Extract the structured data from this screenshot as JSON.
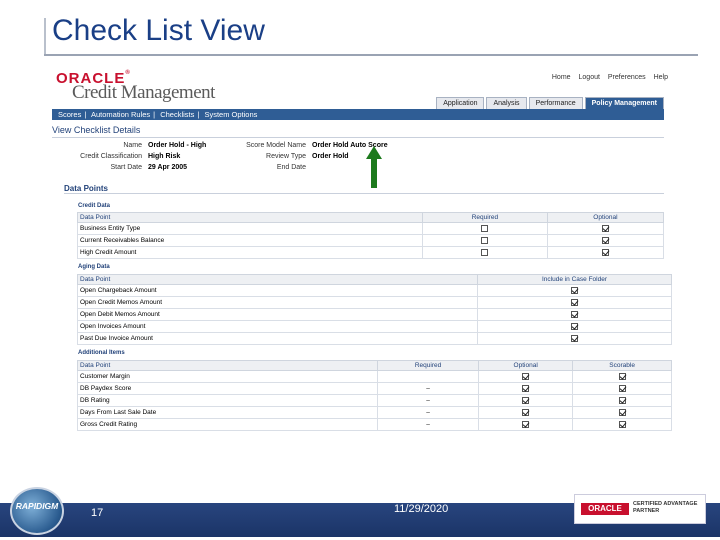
{
  "slide": {
    "title": "Check List View",
    "page_number": "17",
    "date": "11/29/2020"
  },
  "branding": {
    "footer_logo_text": "RAPIDIGM",
    "partner_oracle": "ORACLE",
    "partner_line1": "CERTIFIED ADVANTAGE",
    "partner_line2": "PARTNER"
  },
  "app": {
    "vendor": "ORACLE",
    "name": "Credit Management",
    "global_links": [
      "Home",
      "Logout",
      "Preferences",
      "Help"
    ],
    "tabs": [
      "Application",
      "Analysis",
      "Performance",
      "Policy Management"
    ],
    "active_tab": "Policy Management",
    "subnav": [
      "Scores",
      "Automation Rules",
      "Checklists",
      "System Options"
    ],
    "page_title": "View Checklist Details",
    "details": {
      "name_label": "Name",
      "name_value": "Order Hold - High",
      "classification_label": "Credit Classification",
      "classification_value": "High Risk",
      "start_label": "Start Date",
      "start_value": "29 Apr 2005",
      "score_label": "Score Model Name",
      "score_value": "Order Hold Auto Score",
      "review_label": "Review Type",
      "review_value": "Order Hold",
      "end_label": "End Date",
      "end_value": ""
    },
    "data_points_heading": "Data Points",
    "credit_data": {
      "title": "Credit Data",
      "columns": [
        "Data Point",
        "Required",
        "Optional"
      ],
      "rows": [
        {
          "label": "Business Entity Type",
          "required": false,
          "optional": true
        },
        {
          "label": "Current Receivables Balance",
          "required": false,
          "optional": true
        },
        {
          "label": "High Credit Amount",
          "required": false,
          "optional": true
        }
      ]
    },
    "aging_data": {
      "title": "Aging Data",
      "columns": [
        "Data Point",
        "Include in Case Folder"
      ],
      "rows": [
        {
          "label": "Open Chargeback Amount",
          "include": true
        },
        {
          "label": "Open Credit Memos Amount",
          "include": true
        },
        {
          "label": "Open Debit Memos Amount",
          "include": true
        },
        {
          "label": "Open Invoices Amount",
          "include": true
        },
        {
          "label": "Past Due Invoice Amount",
          "include": true
        }
      ]
    },
    "additional_items": {
      "title": "Additional Items",
      "columns": [
        "Data Point",
        "Required",
        "Optional",
        "Scorable"
      ],
      "rows": [
        {
          "label": "Customer Margin",
          "required": "",
          "optional": true,
          "scorable": true
        },
        {
          "label": "DB Paydex Score",
          "required": "–",
          "optional": true,
          "scorable": true
        },
        {
          "label": "DB Rating",
          "required": "–",
          "optional": true,
          "scorable": true
        },
        {
          "label": "Days From Last Sale Date",
          "required": "–",
          "optional": true,
          "scorable": true
        },
        {
          "label": "Gross Credit Rating",
          "required": "–",
          "optional": true,
          "scorable": true
        }
      ]
    }
  }
}
